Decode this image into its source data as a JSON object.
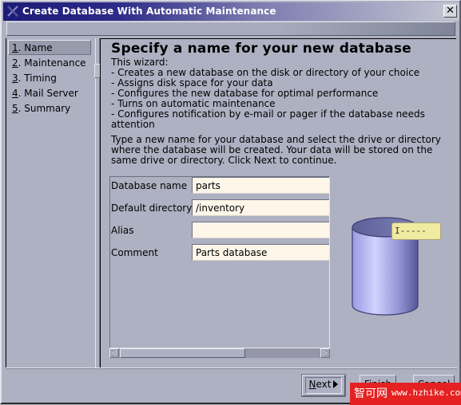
{
  "window": {
    "title": "Create Database With Automatic Maintenance",
    "close_icon": "close-icon",
    "app_icon": "x-window-icon"
  },
  "nav": {
    "items": [
      {
        "number": "1",
        "label": ". Name",
        "active": true
      },
      {
        "number": "2",
        "label": ". Maintenance",
        "active": false
      },
      {
        "number": "3",
        "label": ". Timing",
        "active": false
      },
      {
        "number": "4",
        "label": ". Mail Server",
        "active": false
      },
      {
        "number": "5",
        "label": ". Summary",
        "active": false
      }
    ]
  },
  "page": {
    "heading": "Specify a name for your new database",
    "intro": [
      "This wizard:",
      "- Creates a new database on the disk or directory of your choice",
      "- Assigns disk space for your data",
      "- Configures the new database for optimal performance",
      "- Turns on automatic maintenance",
      "- Configures notification by e-mail or pager if the database needs attention"
    ],
    "instructions": "Type a new name for your database and select the drive or directory where the database will be created. Your data will be stored on the same drive or directory. Click Next to continue."
  },
  "form": {
    "fields": [
      {
        "label": "Database name",
        "value": "parts"
      },
      {
        "label": "Default directory",
        "value": "/inventory"
      },
      {
        "label": "Alias",
        "value": ""
      },
      {
        "label": "Comment",
        "value": "Parts database"
      }
    ],
    "scroll": {
      "left_arrow": "◁",
      "right_arrow": "▷"
    }
  },
  "graphic": {
    "icon": "database-cylinder-icon",
    "tooltip_text": "I-----"
  },
  "buttons": {
    "next": {
      "mnemonic": "N",
      "rest": "ext"
    },
    "finish": "Finish",
    "cancel": "Cancel"
  },
  "watermark": {
    "cn": "智可网",
    "url": "www.hzhike.com"
  }
}
